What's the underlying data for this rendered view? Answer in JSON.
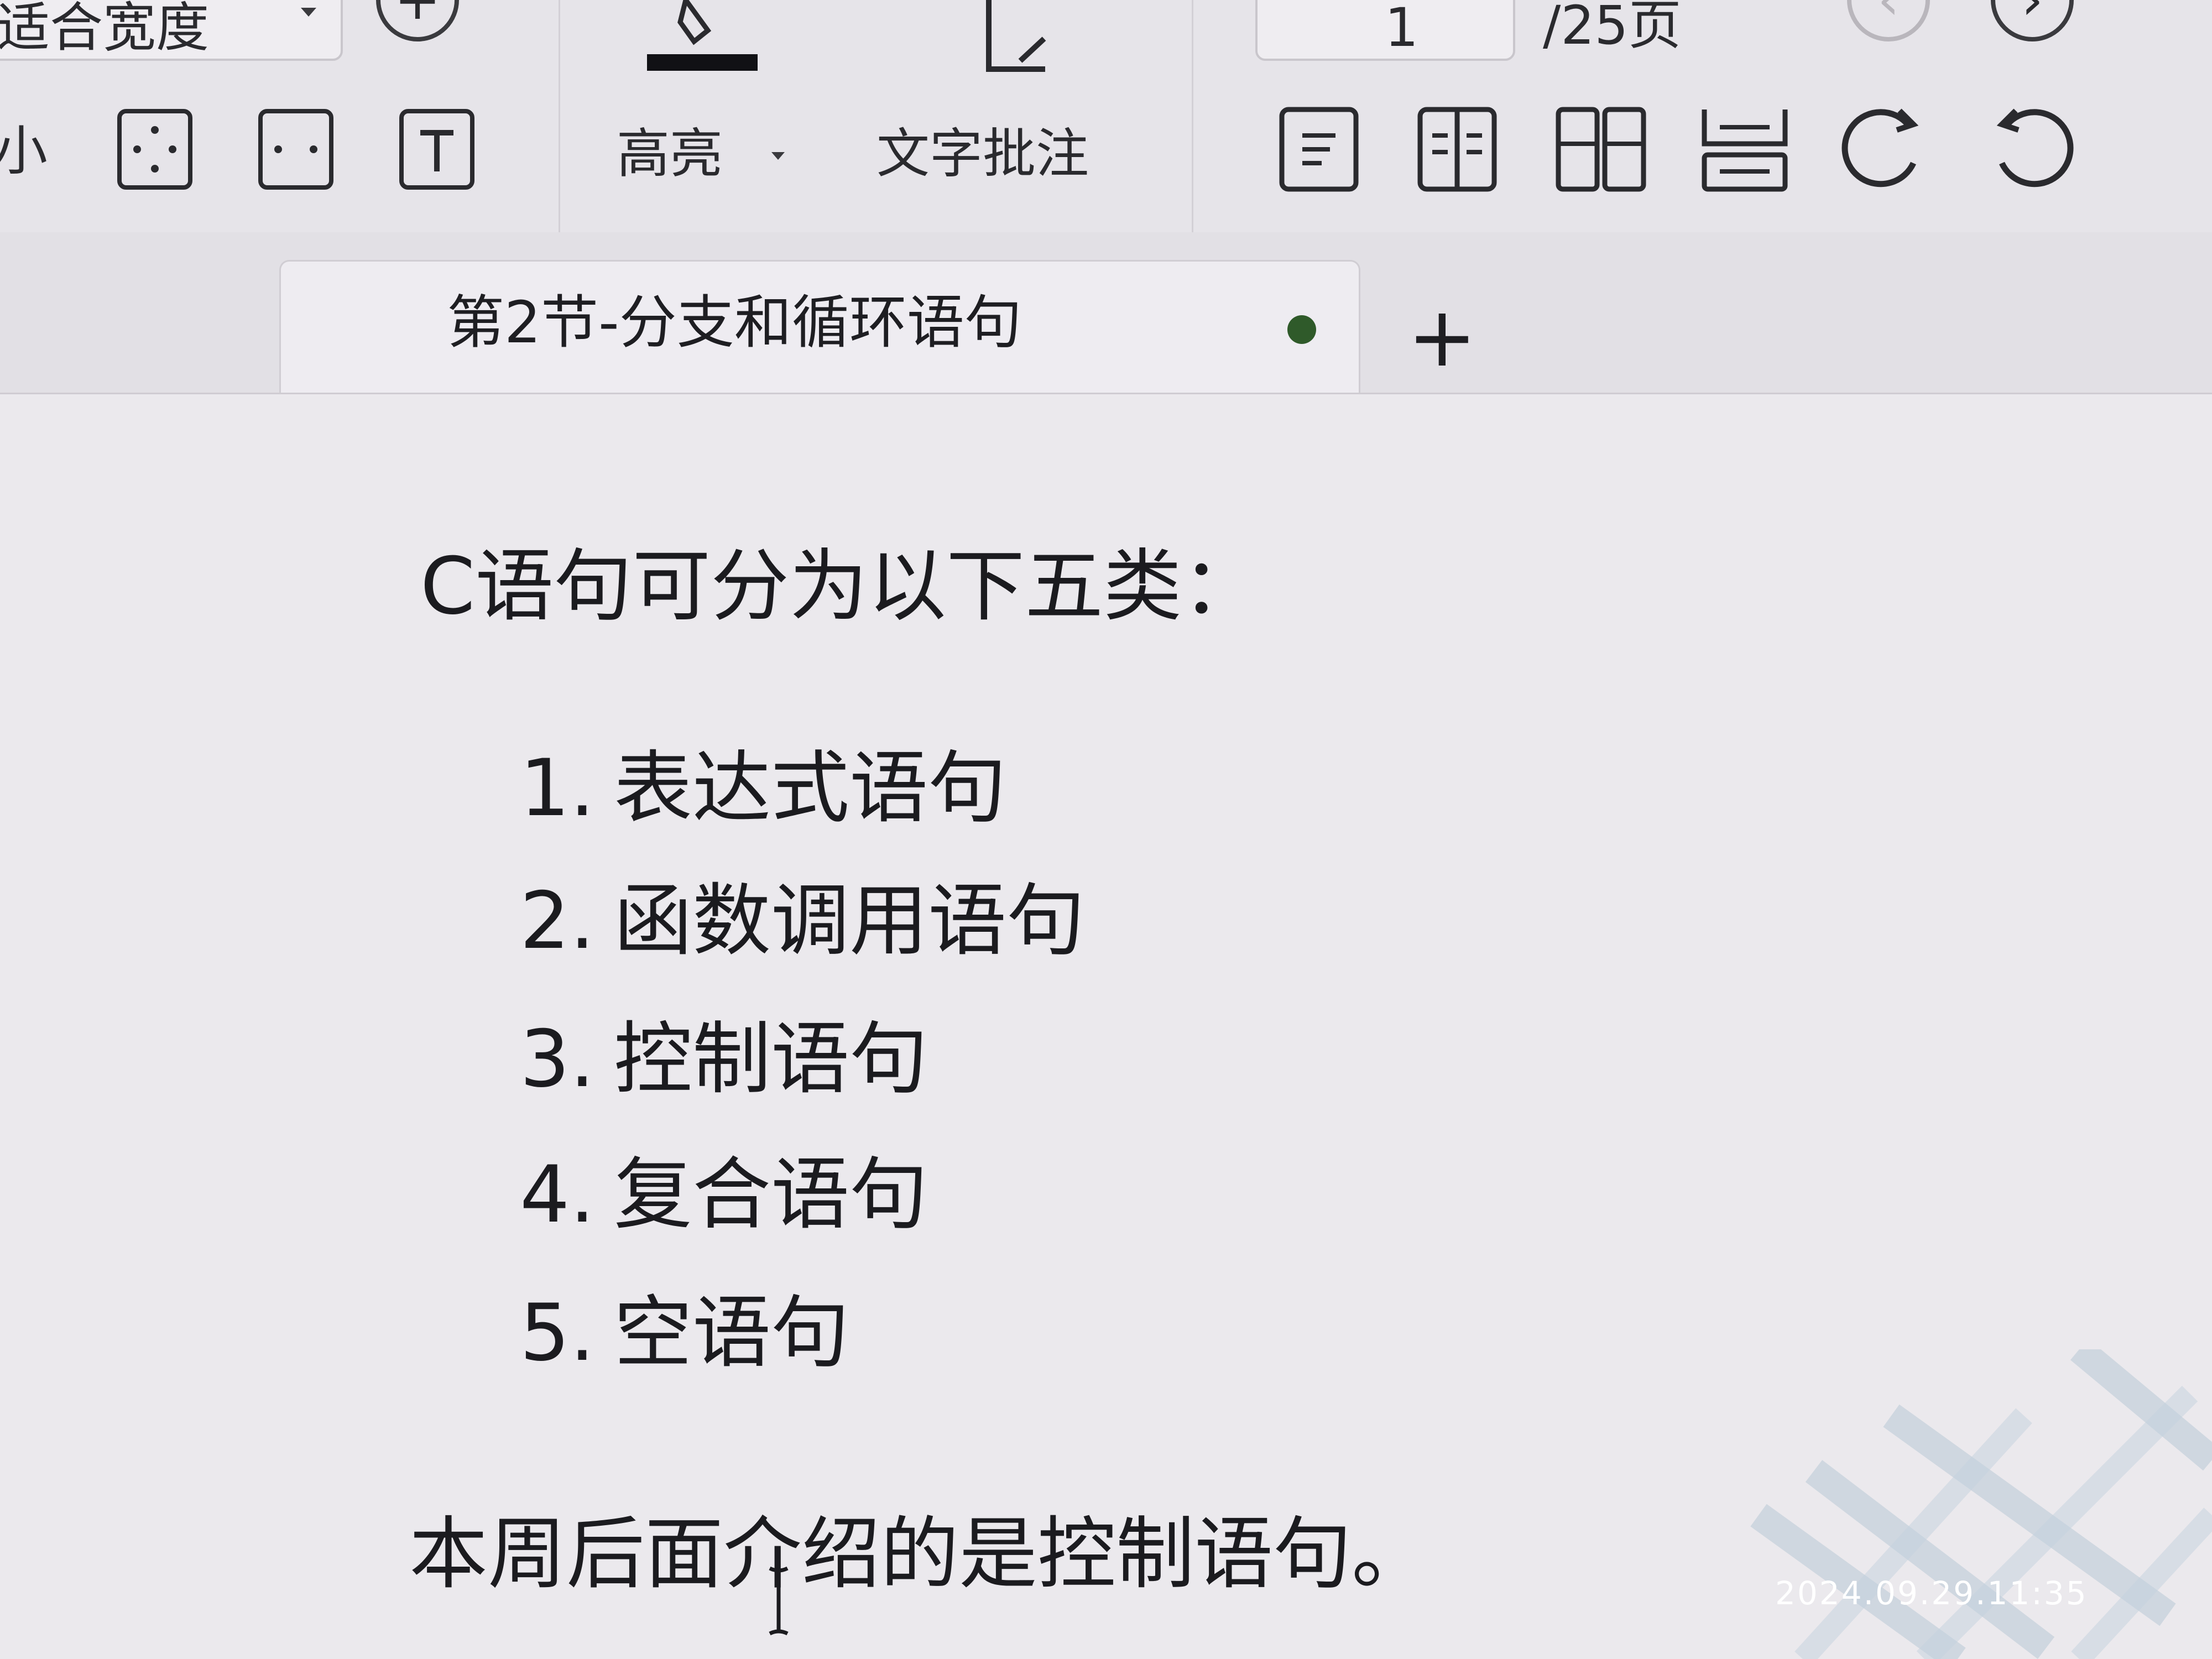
{
  "toolbar": {
    "partial_dropdown_label": "适合宽度",
    "partial_page_input_value": "1",
    "partial_page_total": "/25页",
    "partial_side_label": "小",
    "highlight_label": "高亮",
    "text_comment_label": "文字批注"
  },
  "tab": {
    "title": "第2节-分支和循环语句",
    "add_symbol": "+"
  },
  "document": {
    "intro": "C语句可分为以下五类：",
    "list": [
      {
        "num": "1.",
        "text": "表达式语句"
      },
      {
        "num": "2.",
        "text": "函数调用语句"
      },
      {
        "num": "3.",
        "text": "控制语句"
      },
      {
        "num": "4.",
        "text": "复合语句"
      },
      {
        "num": "5.",
        "text": "空语句"
      }
    ],
    "outro": "本周后面介绍的是控制语句。"
  },
  "overlay": {
    "timestamp": "2024.09.29.11:35"
  },
  "colors": {
    "background": "#e9e7ec",
    "text": "#1b1b1f",
    "unsaved_dot": "#2f5a2a"
  }
}
